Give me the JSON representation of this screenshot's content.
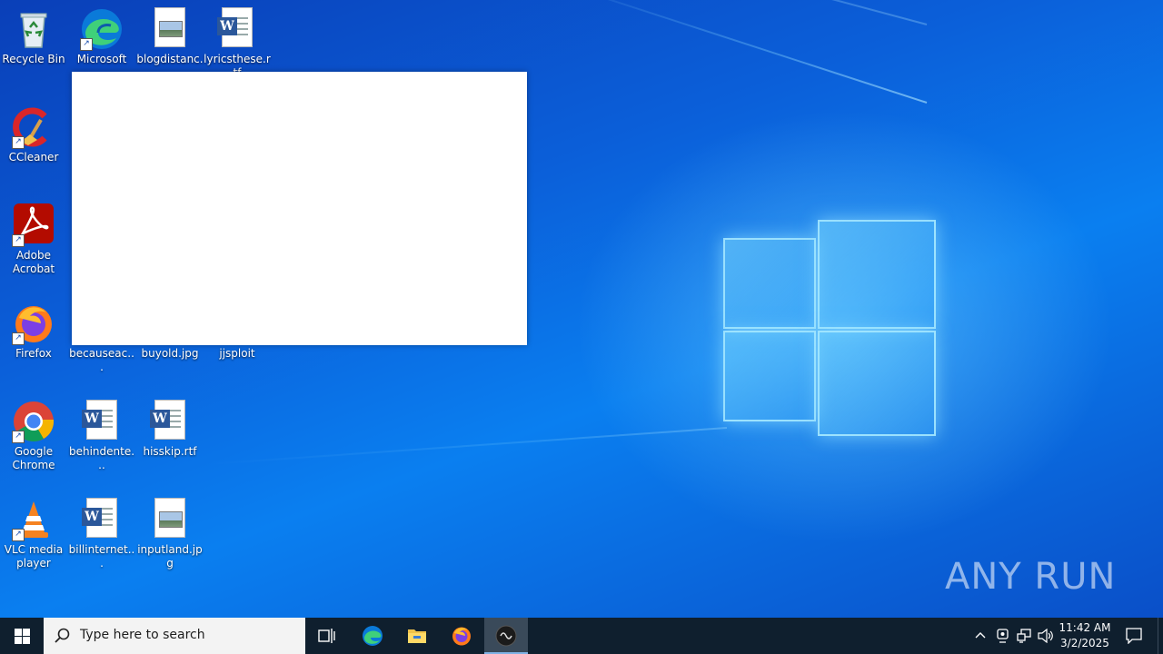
{
  "desktop": {
    "icons": [
      {
        "label": "Recycle Bin"
      },
      {
        "label": "Microsoft Edge"
      },
      {
        "label": "blogdistanc..."
      },
      {
        "label": "lyricsthese.rtf"
      },
      {
        "label": "CCleaner"
      },
      {
        "label": "Adobe Acrobat"
      },
      {
        "label": "Firefox"
      },
      {
        "label": "becauseac..."
      },
      {
        "label": "buyold.jpg"
      },
      {
        "label": "jjsploit"
      },
      {
        "label": "Google Chrome"
      },
      {
        "label": "behindente..."
      },
      {
        "label": "hisskip.rtf"
      },
      {
        "label": "VLC media player"
      },
      {
        "label": "billinternet..."
      },
      {
        "label": "inputland.jpg"
      }
    ],
    "watermark": "ANY RUN"
  },
  "taskbar": {
    "search_placeholder": "Type here to search",
    "clock_time": "11:42 AM",
    "clock_date": "3/2/2025",
    "accent": "#0f1f2e"
  },
  "colors": {
    "desktop_blue": "#0a6fe6",
    "word_blue": "#2b579a"
  }
}
